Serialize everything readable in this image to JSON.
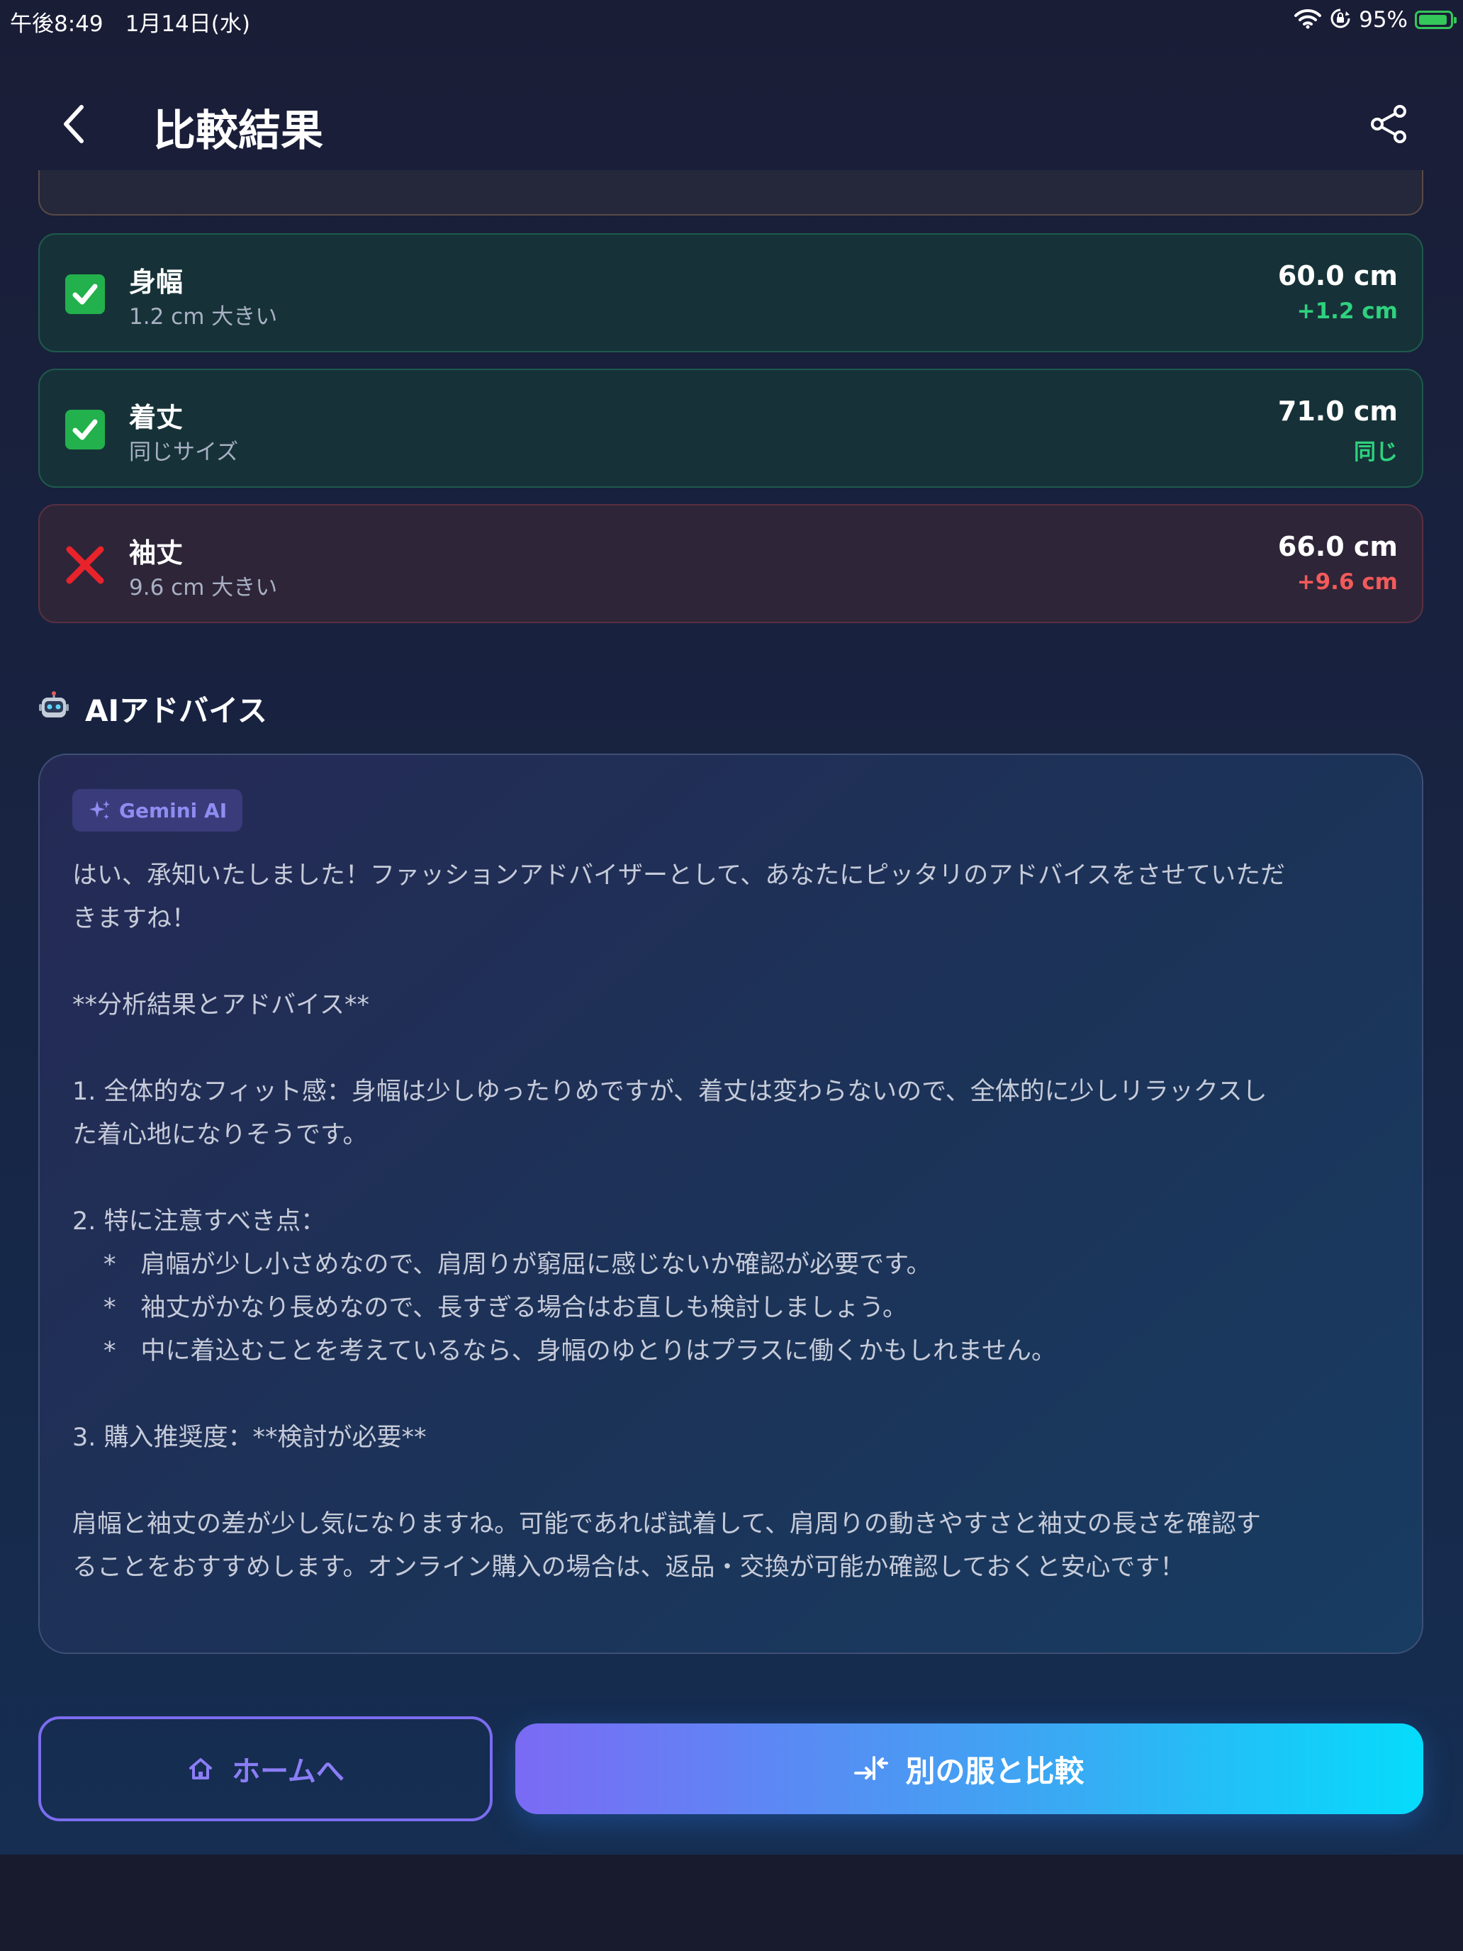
{
  "status": {
    "time": "午後8:49　1月14日(水)",
    "battery": "95%",
    "battery_level": 0.95
  },
  "header": {
    "title": "比較結果"
  },
  "measurements": [
    {
      "name": "身幅",
      "sub": "1.2 cm 大きい",
      "value": "60.0 cm",
      "diff": "+1.2 cm",
      "status": "ok"
    },
    {
      "name": "着丈",
      "sub": "同じサイズ",
      "value": "71.0 cm",
      "diff": "同じ",
      "status": "ok"
    },
    {
      "name": "袖丈",
      "sub": "9.6 cm 大きい",
      "value": "66.0 cm",
      "diff": "+9.6 cm",
      "status": "ng"
    }
  ],
  "ai": {
    "section_title": "AIアドバイス",
    "badge": "Gemini AI",
    "lines": [
      "はい、承知いたしました！ファッションアドバイザーとして、あなたにピッタリのアドバイスをさせていただ",
      "きますね！",
      "",
      "**分析結果とアドバイス**",
      "",
      "1.  全体的なフィット感：身幅は少しゆったりめですが、着丈は変わらないので、全体的に少しリラックスし",
      "た着心地になりそうです。",
      "",
      "2.  特に注意すべき点：",
      "*　肩幅が少し小さめなので、肩周りが窮屈に感じないか確認が必要です。",
      "*　袖丈がかなり長めなので、長すぎる場合はお直しも検討しましょう。",
      "*　中に着込むことを考えているなら、身幅のゆとりはプラスに働くかもしれません。",
      "",
      "3.  購入推奨度：**検討が必要**",
      "",
      "肩幅と袖丈の差が少し気になりますね。可能であれば試着して、肩周りの動きやすさと袖丈の長さを確認す",
      "ることをおすすめします。オンライン購入の場合は、返品・交換が可能か確認しておくと安心です！"
    ]
  },
  "buttons": {
    "home_label": "ホームへ",
    "compare_label": "別の服と比較"
  },
  "colors": {
    "accent_purple": "#7c6cf0",
    "accent_cyan": "#05dcfb",
    "ok_green": "#2fd17e",
    "ng_red": "#f25a5a"
  }
}
